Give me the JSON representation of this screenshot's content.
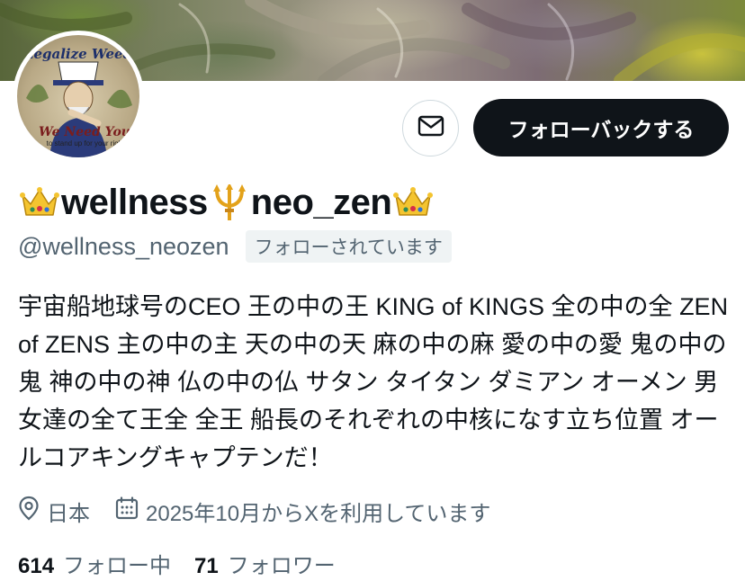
{
  "avatar": {
    "top_text": "Legalize Weed",
    "bottom_text": "We Need You",
    "sub_text": "to stand up for your rights"
  },
  "actions": {
    "message_icon": "envelope-icon",
    "follow_back_label": "フォローバックする"
  },
  "profile": {
    "name_prefix_emoji": "crown-emoji",
    "name_part1": "wellness",
    "name_middle_emoji": "trident-emoji",
    "name_part2": "neo_zen",
    "name_suffix_emoji": "crown-emoji",
    "handle": "@wellness_neozen",
    "follows_you_badge": "フォローされています",
    "bio": "宇宙船地球号のCEO 王の中の王 KING of KINGS 全の中の全 ZEN of ZENS 主の中の主 天の中の天 麻の中の麻 愛の中の愛 鬼の中の鬼 神の中の神 仏の中の仏 サタン タイタン ダミアン オーメン 男女達の全て王全 全王 船長のそれぞれの中核になす立ち位置 オールコアキングキャプテンだ！",
    "location": "日本",
    "joined": "2025年10月からXを利用しています"
  },
  "stats": {
    "following_count": "614",
    "following_label": "フォロー中",
    "followers_count": "71",
    "followers_label": "フォロワー"
  },
  "colors": {
    "primary_text": "#0f1419",
    "secondary_text": "#536471",
    "button_dark": "#0f1419",
    "badge_bg": "#eff3f4",
    "border": "#cfd9de"
  }
}
